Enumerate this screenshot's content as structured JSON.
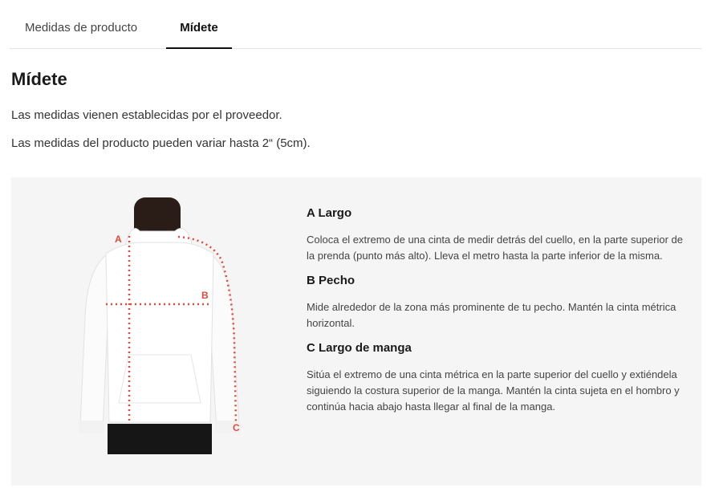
{
  "tabs": [
    {
      "label": "Medidas de producto",
      "active": false
    },
    {
      "label": "Mídete",
      "active": true
    }
  ],
  "section_title": "Mídete",
  "notes": [
    "Las medidas vienen establecidas por el proveedor.",
    "Las medidas del producto pueden variar hasta 2“ (5cm)."
  ],
  "figure": {
    "labels": {
      "a": "A",
      "b": "B",
      "c": "C"
    },
    "accent_color": "#e04a3a"
  },
  "measures": [
    {
      "title": "A Largo",
      "text": "Coloca el extremo de una cinta de medir detrás del cuello, en la parte superior de la prenda (punto más alto). Lleva el metro hasta la parte inferior de la misma."
    },
    {
      "title": "B Pecho",
      "text": "Mide alrededor de la zona más prominente de tu pecho. Mantén la cinta métrica horizontal."
    },
    {
      "title": "C Largo de manga",
      "text": "Sitúa el extremo de una cinta métrica en la parte superior del cuello y extiéndela siguiendo la costura superior de la manga. Mantén la cinta sujeta en el hombro y continúa hacia abajo hasta llegar al final de la manga."
    }
  ]
}
